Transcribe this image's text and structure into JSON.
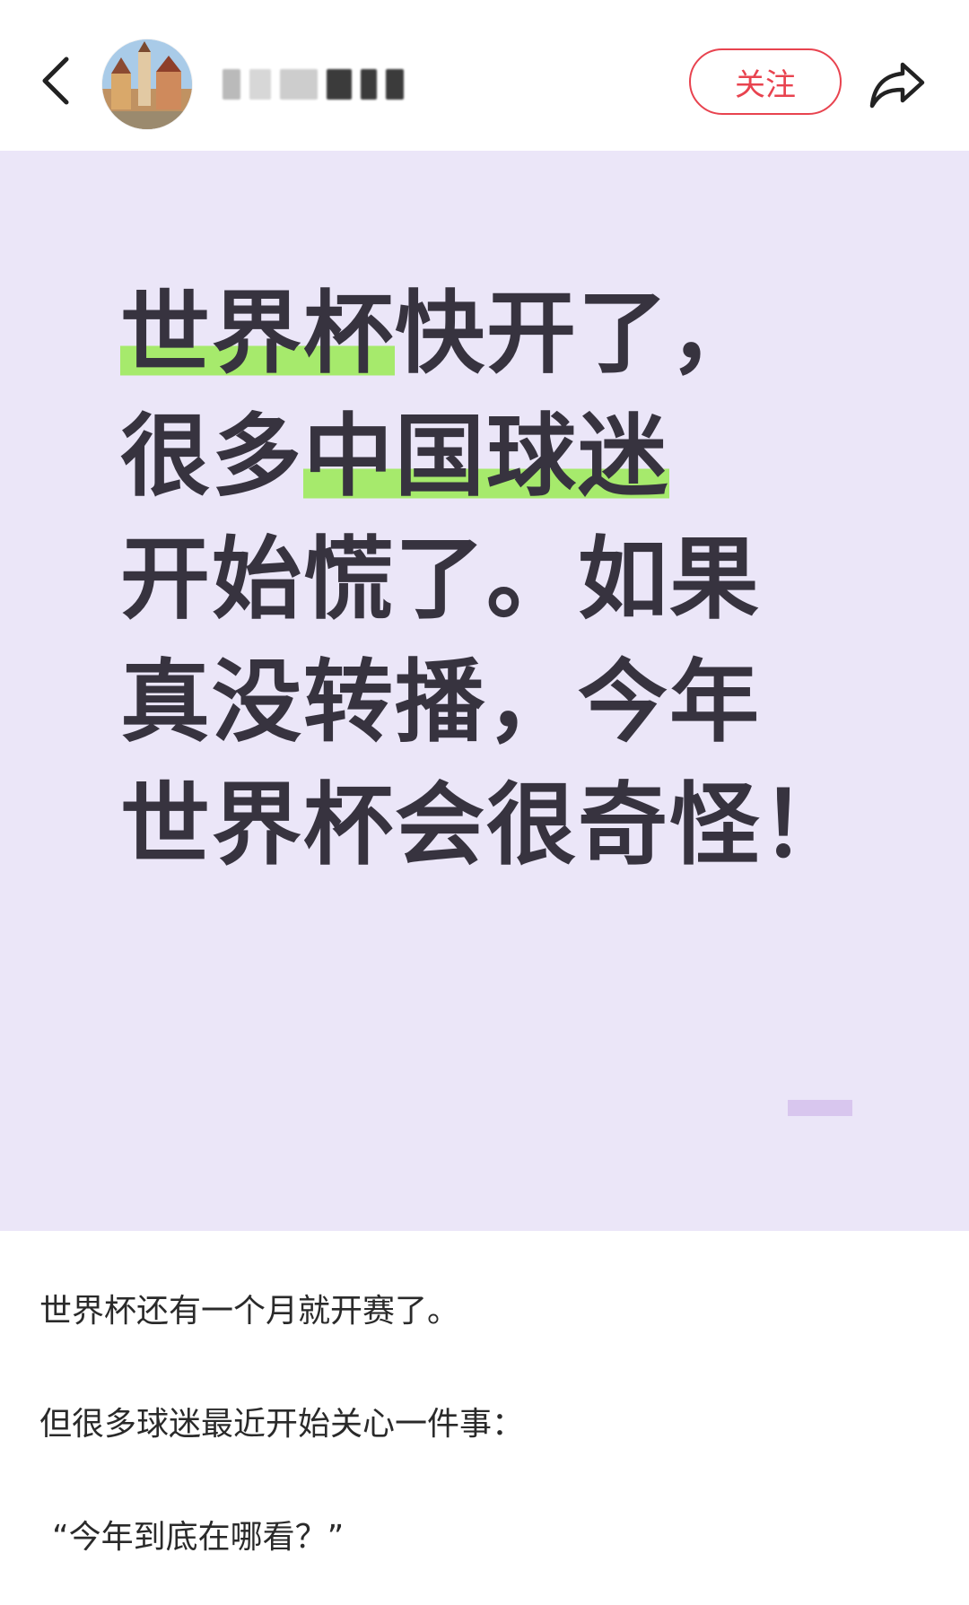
{
  "header": {
    "back_icon": "chevron-left-icon",
    "avatar_desc": "avatar",
    "username_redacted": true,
    "follow_label": "关注",
    "share_icon": "share-arrow-icon",
    "accent_color": "#e8434f"
  },
  "cover": {
    "background_color": "#ebe6f8",
    "highlight_color": "#a6ea6c",
    "lines": [
      {
        "pre": "",
        "hl": "世界杯",
        "post": "快开了，"
      },
      {
        "pre": "很多",
        "hl": "中国球迷",
        "post": ""
      },
      {
        "pre": "开始慌了。如果",
        "hl": "",
        "post": ""
      },
      {
        "pre": "真没转播，今年",
        "hl": "",
        "post": ""
      },
      {
        "pre": "世界杯会很奇怪！",
        "hl": "",
        "post": ""
      }
    ]
  },
  "body": {
    "paragraphs": [
      "世界杯还有一个月就开赛了。",
      "但很多球迷最近开始关心一件事：",
      "“今年到底在哪看？”"
    ]
  }
}
